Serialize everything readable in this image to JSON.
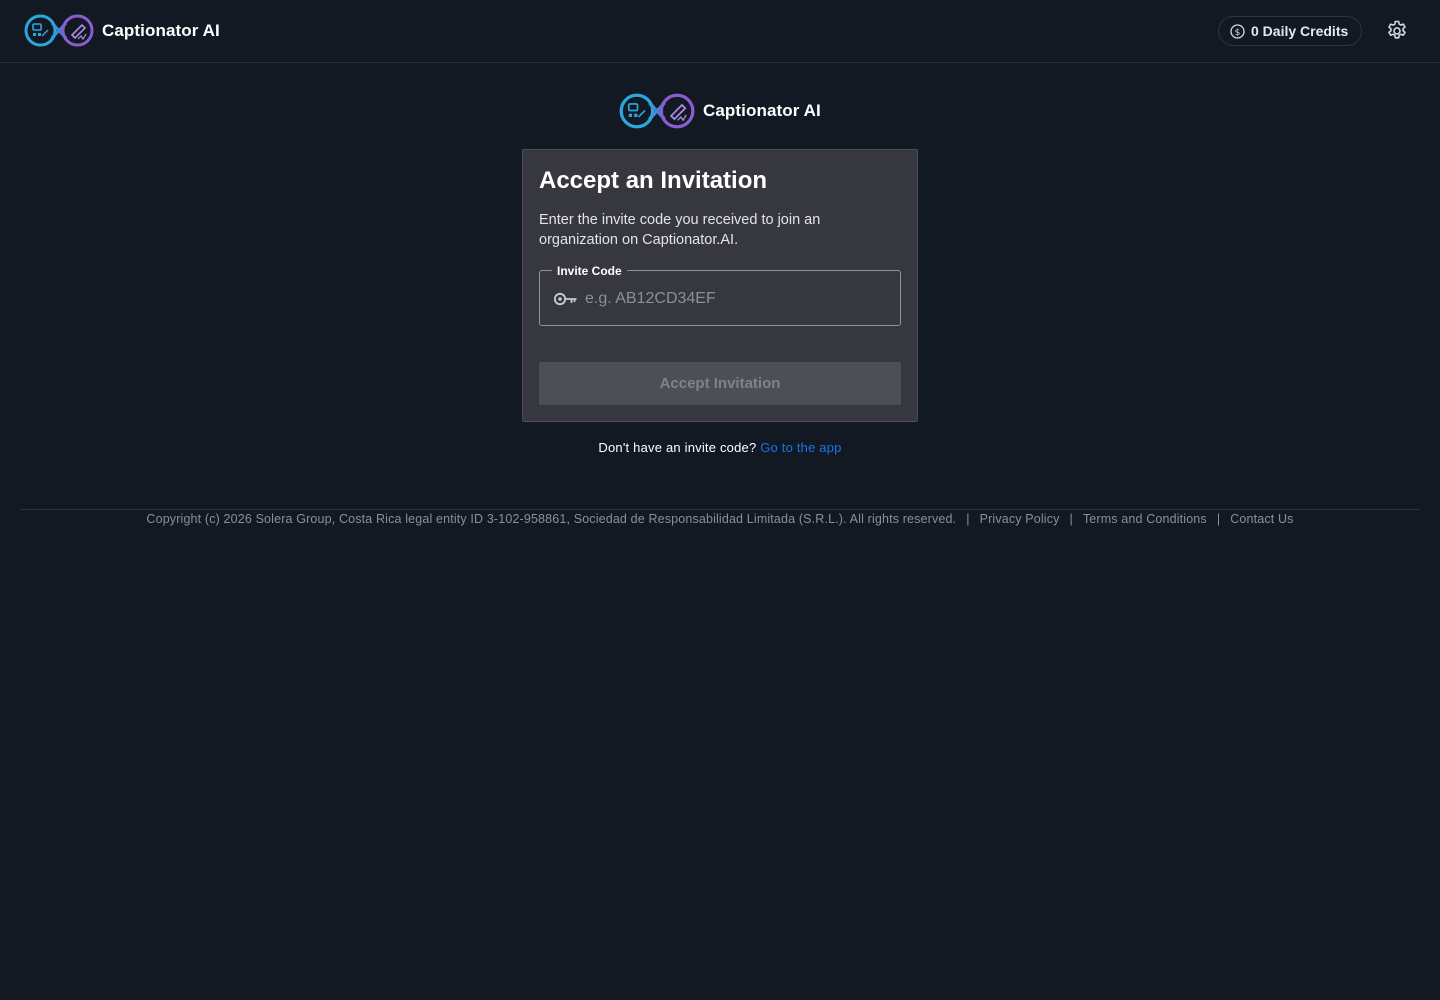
{
  "header": {
    "brand_name": "Captionator AI",
    "credits_label": "0 Daily Credits"
  },
  "center_brand": {
    "brand_name": "Captionator AI"
  },
  "card": {
    "title": "Accept an Invitation",
    "description": "Enter the invite code you received to join an organization on Captionator.AI.",
    "invite_field": {
      "label": "Invite Code",
      "placeholder": "e.g. AB12CD34EF",
      "value": ""
    },
    "submit_label": "Accept Invitation"
  },
  "help": {
    "prompt": "Don't have an invite code?",
    "link_label": "Go to the app"
  },
  "footer": {
    "copyright": "Copyright (c) 2026 Solera Group, Costa Rica legal entity ID 3-102-958861, Sociedad de Responsabilidad Limitada (S.R.L.). All rights reserved.",
    "links": [
      "Privacy Policy",
      "Terms and Conditions",
      "Contact Us"
    ]
  },
  "colors": {
    "background": "#131923",
    "card": "#373740",
    "link": "#1a73e8",
    "button_disabled": "#4d4e56",
    "logo_blue": "#2a9fd8",
    "logo_purple": "#8a5cd0"
  },
  "icons": {
    "logo": "infinity-logo-icon",
    "credits": "dollar-coin-icon",
    "settings": "gear-icon",
    "field": "key-icon"
  }
}
